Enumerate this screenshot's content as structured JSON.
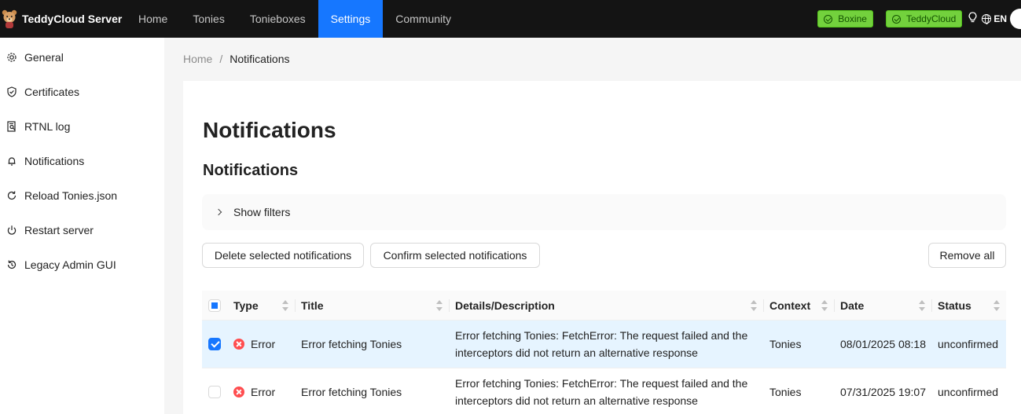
{
  "header": {
    "brand": "TeddyCloud Server",
    "nav": [
      "Home",
      "Tonies",
      "Tonieboxes",
      "Settings",
      "Community"
    ],
    "active_nav": "Settings",
    "tags": [
      "Boxine",
      "TeddyCloud"
    ],
    "lang": "EN",
    "colors": {
      "bar": "#141414",
      "active": "#1677ff",
      "tag": "#73d13d"
    }
  },
  "sidebar": {
    "items": [
      {
        "label": "General",
        "icon": "gear-icon"
      },
      {
        "label": "Certificates",
        "icon": "shield-icon"
      },
      {
        "label": "RTNL log",
        "icon": "log-search-icon"
      },
      {
        "label": "Notifications",
        "icon": "bell-icon"
      },
      {
        "label": "Reload Tonies.json",
        "icon": "reload-icon"
      },
      {
        "label": "Restart server",
        "icon": "power-icon"
      },
      {
        "label": "Legacy Admin GUI",
        "icon": "history-icon"
      }
    ]
  },
  "breadcrumb": {
    "home": "Home",
    "separator": "/",
    "current": "Notifications"
  },
  "main": {
    "title": "Notifications",
    "subtitle": "Notifications",
    "filters_label": "Show filters",
    "buttons": {
      "delete_selected": "Delete selected notifications",
      "confirm_selected": "Confirm selected notifications",
      "remove_all": "Remove all"
    }
  },
  "table": {
    "columns": [
      "Type",
      "Title",
      "Details/Description",
      "Context",
      "Date",
      "Status"
    ],
    "rows": [
      {
        "selected": true,
        "type": "Error",
        "title": "Error fetching Tonies",
        "details_line1": "Error fetching Tonies: FetchError: The request failed and the",
        "details_line2": "interceptors did not return an alternative response",
        "context": "Tonies",
        "date": "08/01/2025 08:18",
        "status": "unconfirmed"
      },
      {
        "selected": false,
        "type": "Error",
        "title": "Error fetching Tonies",
        "details_line1": "Error fetching Tonies: FetchError: The request failed and the",
        "details_line2": "interceptors did not return an alternative response",
        "context": "Tonies",
        "date": "07/31/2025 19:07",
        "status": "unconfirmed"
      }
    ]
  }
}
